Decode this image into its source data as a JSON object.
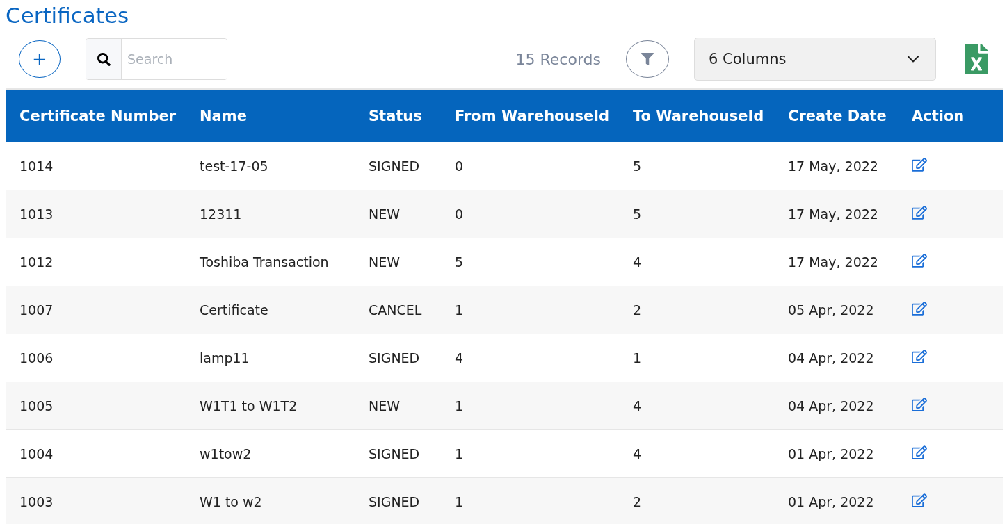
{
  "title": "Certificates",
  "toolbar": {
    "add_button": "+",
    "search": {
      "placeholder": "Search"
    },
    "records": "15 Records",
    "columns_select": "6 Columns"
  },
  "table": {
    "columns": [
      "Certificate Number",
      "Name",
      "Status",
      "From WarehouseId",
      "To WarehouseId",
      "Create Date",
      "Action"
    ],
    "rows": [
      {
        "cells": [
          "1014",
          "test-17-05",
          "SIGNED",
          "0",
          "5",
          "17 May, 2022"
        ]
      },
      {
        "cells": [
          "1013",
          "12311",
          "NEW",
          "0",
          "5",
          "17 May, 2022"
        ]
      },
      {
        "cells": [
          "1012",
          "Toshiba Transaction",
          "NEW",
          "5",
          "4",
          "17 May, 2022"
        ]
      },
      {
        "cells": [
          "1007",
          "Certificate",
          "CANCEL",
          "1",
          "2",
          "05 Apr, 2022"
        ]
      },
      {
        "cells": [
          "1006",
          "lamp11",
          "SIGNED",
          "4",
          "1",
          "04 Apr, 2022"
        ]
      },
      {
        "cells": [
          "1005",
          "W1T1 to W1T2",
          "NEW",
          "1",
          "4",
          "04 Apr, 2022"
        ]
      },
      {
        "cells": [
          "1004",
          "w1tow2",
          "SIGNED",
          "1",
          "4",
          "01 Apr, 2022"
        ]
      },
      {
        "cells": [
          "1003",
          "W1 to w2",
          "SIGNED",
          "1",
          "2",
          "01 Apr, 2022"
        ]
      }
    ]
  }
}
